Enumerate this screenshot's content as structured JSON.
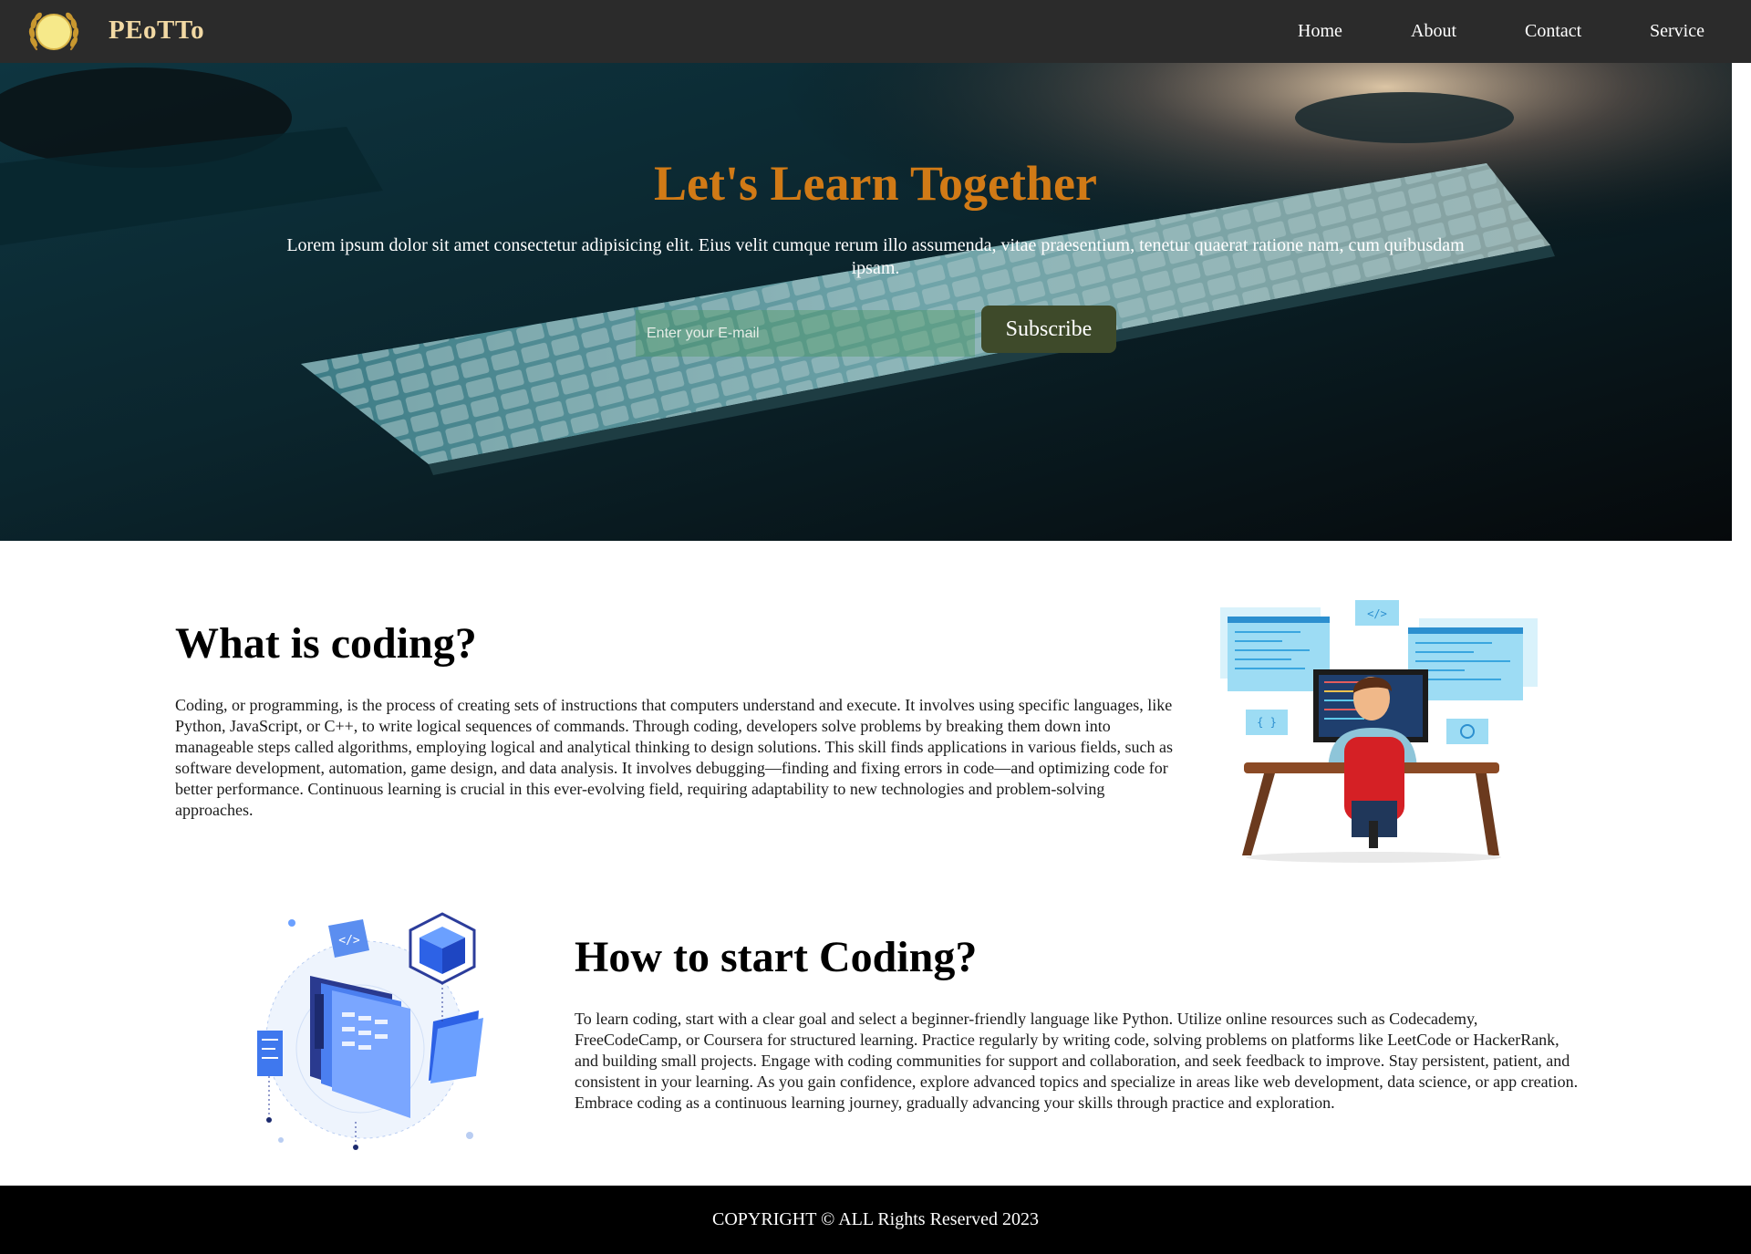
{
  "brand": {
    "name": "PEoTTo",
    "logo_icon": "sun-laurel-icon"
  },
  "nav": {
    "home": "Home",
    "about": "About",
    "contact": "Contact",
    "service": "Service"
  },
  "hero": {
    "title": "Let's Learn Together",
    "text": "Lorem ipsum dolor sit amet consectetur adipisicing elit. Eius velit cumque rerum illo assumenda, vitae praesentium, tenetur quaerat ratione nam, cum quibusdam ipsam.",
    "email_placeholder": "Enter your E-mail",
    "subscribe_label": "Subscribe",
    "background_icon": "keyboard-photo"
  },
  "section1": {
    "title": "What is coding?",
    "text": "Coding, or programming, is the process of creating sets of instructions that computers understand and execute. It involves using specific languages, like Python, JavaScript, or C++, to write logical sequences of commands. Through coding, developers solve problems by breaking them down into manageable steps called algorithms, employing logical and analytical thinking to design solutions. This skill finds applications in various fields, such as software development, automation, game design, and data analysis. It involves debugging—finding and fixing errors in code—and optimizing code for better performance. Continuous learning is crucial in this ever-evolving field, requiring adaptability to new technologies and problem-solving approaches.",
    "illustration_icon": "developer-at-desk-illustration"
  },
  "section2": {
    "title": "How to start Coding?",
    "text": "To learn coding, start with a clear goal and select a beginner-friendly language like Python. Utilize online resources such as Codecademy, FreeCodeCamp, or Coursera for structured learning. Practice regularly by writing code, solving problems on platforms like LeetCode or HackerRank, and building small projects. Engage with coding communities for support and collaboration, and seek feedback to improve. Stay persistent, patient, and consistent in your learning. As you gain confidence, explore advanced topics and specialize in areas like web development, data science, or app creation. Embrace coding as a continuous learning journey, gradually advancing your skills through practice and exploration.",
    "illustration_icon": "isometric-code-illustration"
  },
  "footer": {
    "copyright": "COPYRIGHT © ALL Rights Reserved 2023"
  },
  "colors": {
    "nav_bg": "#2b2b2b",
    "brand": "#f2d9a4",
    "hero_title": "#d17a16",
    "subscribe_bg": "#3e4a2a",
    "footer_bg": "#000000"
  }
}
